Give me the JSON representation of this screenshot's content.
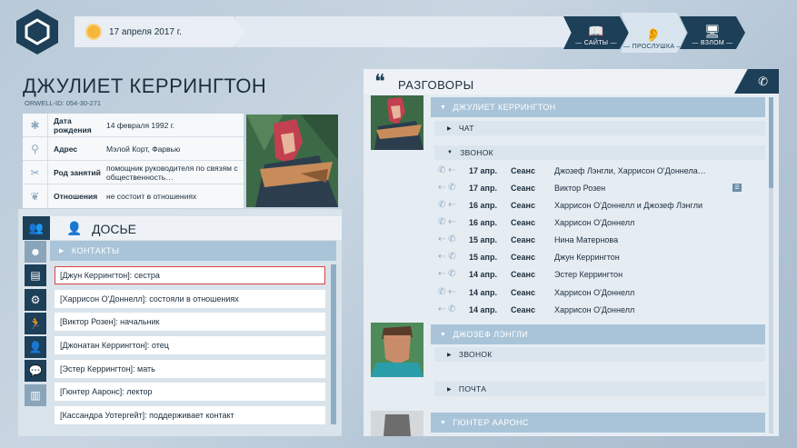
{
  "header": {
    "date": "17 апреля 2017 г.",
    "modes": [
      {
        "label": "— САЙТЫ —",
        "icon": "book-icon"
      },
      {
        "label": "— ПРОСЛУШКА —",
        "icon": "ear-icon"
      },
      {
        "label": "— ВЗЛОМ —",
        "icon": "monitor-icon"
      }
    ]
  },
  "profile": {
    "name": "ДЖУЛИЕТ КЕРРИНГТОН",
    "id": "ORWELL-ID: 054-30-271",
    "rows": [
      {
        "label": "Дата рождения",
        "value": "14 февраля 1992 г.",
        "icon": "snowflake-icon"
      },
      {
        "label": "Адрес",
        "value": "Мэлой Корт, Фарвью",
        "icon": "map-pin-icon"
      },
      {
        "label": "Род занятий",
        "value": "помощник руководителя по связям с общественность…",
        "icon": "tools-icon"
      },
      {
        "label": "Отношения",
        "value": "не состоит в отношениях",
        "icon": "hearts-icon"
      }
    ]
  },
  "dossier": {
    "title": "ДОСЬЕ",
    "section": "КОНТАКТЫ",
    "contacts": [
      "[Джун Керрингтон]: сестра",
      "[Харрисон О'Доннелл]: состояли в отношениях",
      "[Виктор Розен]: начальник",
      "[Джонатан Керрингтон]: отец",
      "[Эстер Керрингтон]: мать",
      "[Гюнтер Ааронс]: лектор",
      "[Кассандра Уотергейт]: поддерживает контакт"
    ],
    "side_icons": [
      "mask-icon",
      "book-icon",
      "gears-icon",
      "runner-icon",
      "person-icon",
      "chat-icon",
      "phone-book-icon"
    ]
  },
  "conversations": {
    "title": "РАЗГОВОРЫ",
    "person1": {
      "name": "ДЖУЛИЕТ КЕРРИНГТОН",
      "chat_label": "ЧАТ",
      "call_label": "ЗВОНОК",
      "calls": [
        {
          "date": "17 апр.",
          "type": "Сеанс",
          "who": "Джозеф Лэнгли, Харрисон О'Доннела…"
        },
        {
          "date": "17 апр.",
          "type": "Сеанс",
          "who": "Виктор Розен"
        },
        {
          "date": "16 апр.",
          "type": "Сеанс",
          "who": "Харрисон О'Доннелл и Джозеф Лэнгли"
        },
        {
          "date": "16 апр.",
          "type": "Сеанс",
          "who": "Харрисон О'Доннелл"
        },
        {
          "date": "15 апр.",
          "type": "Сеанс",
          "who": "Нина Матернова"
        },
        {
          "date": "15 апр.",
          "type": "Сеанс",
          "who": "Джун Керрингтон"
        },
        {
          "date": "14 апр.",
          "type": "Сеанс",
          "who": "Эстер Керрингтон"
        },
        {
          "date": "14 апр.",
          "type": "Сеанс",
          "who": "Харрисон О'Доннелл"
        },
        {
          "date": "14 апр.",
          "type": "Сеанс",
          "who": "Харрисон О'Доннелл"
        }
      ]
    },
    "person2": {
      "name": "ДЖОЗЕФ ЛЭНГЛИ",
      "call_label": "ЗВОНОК",
      "mail_label": "ПОЧТА"
    },
    "person3": {
      "name": "ГЮНТЕР ААРОНС"
    }
  }
}
